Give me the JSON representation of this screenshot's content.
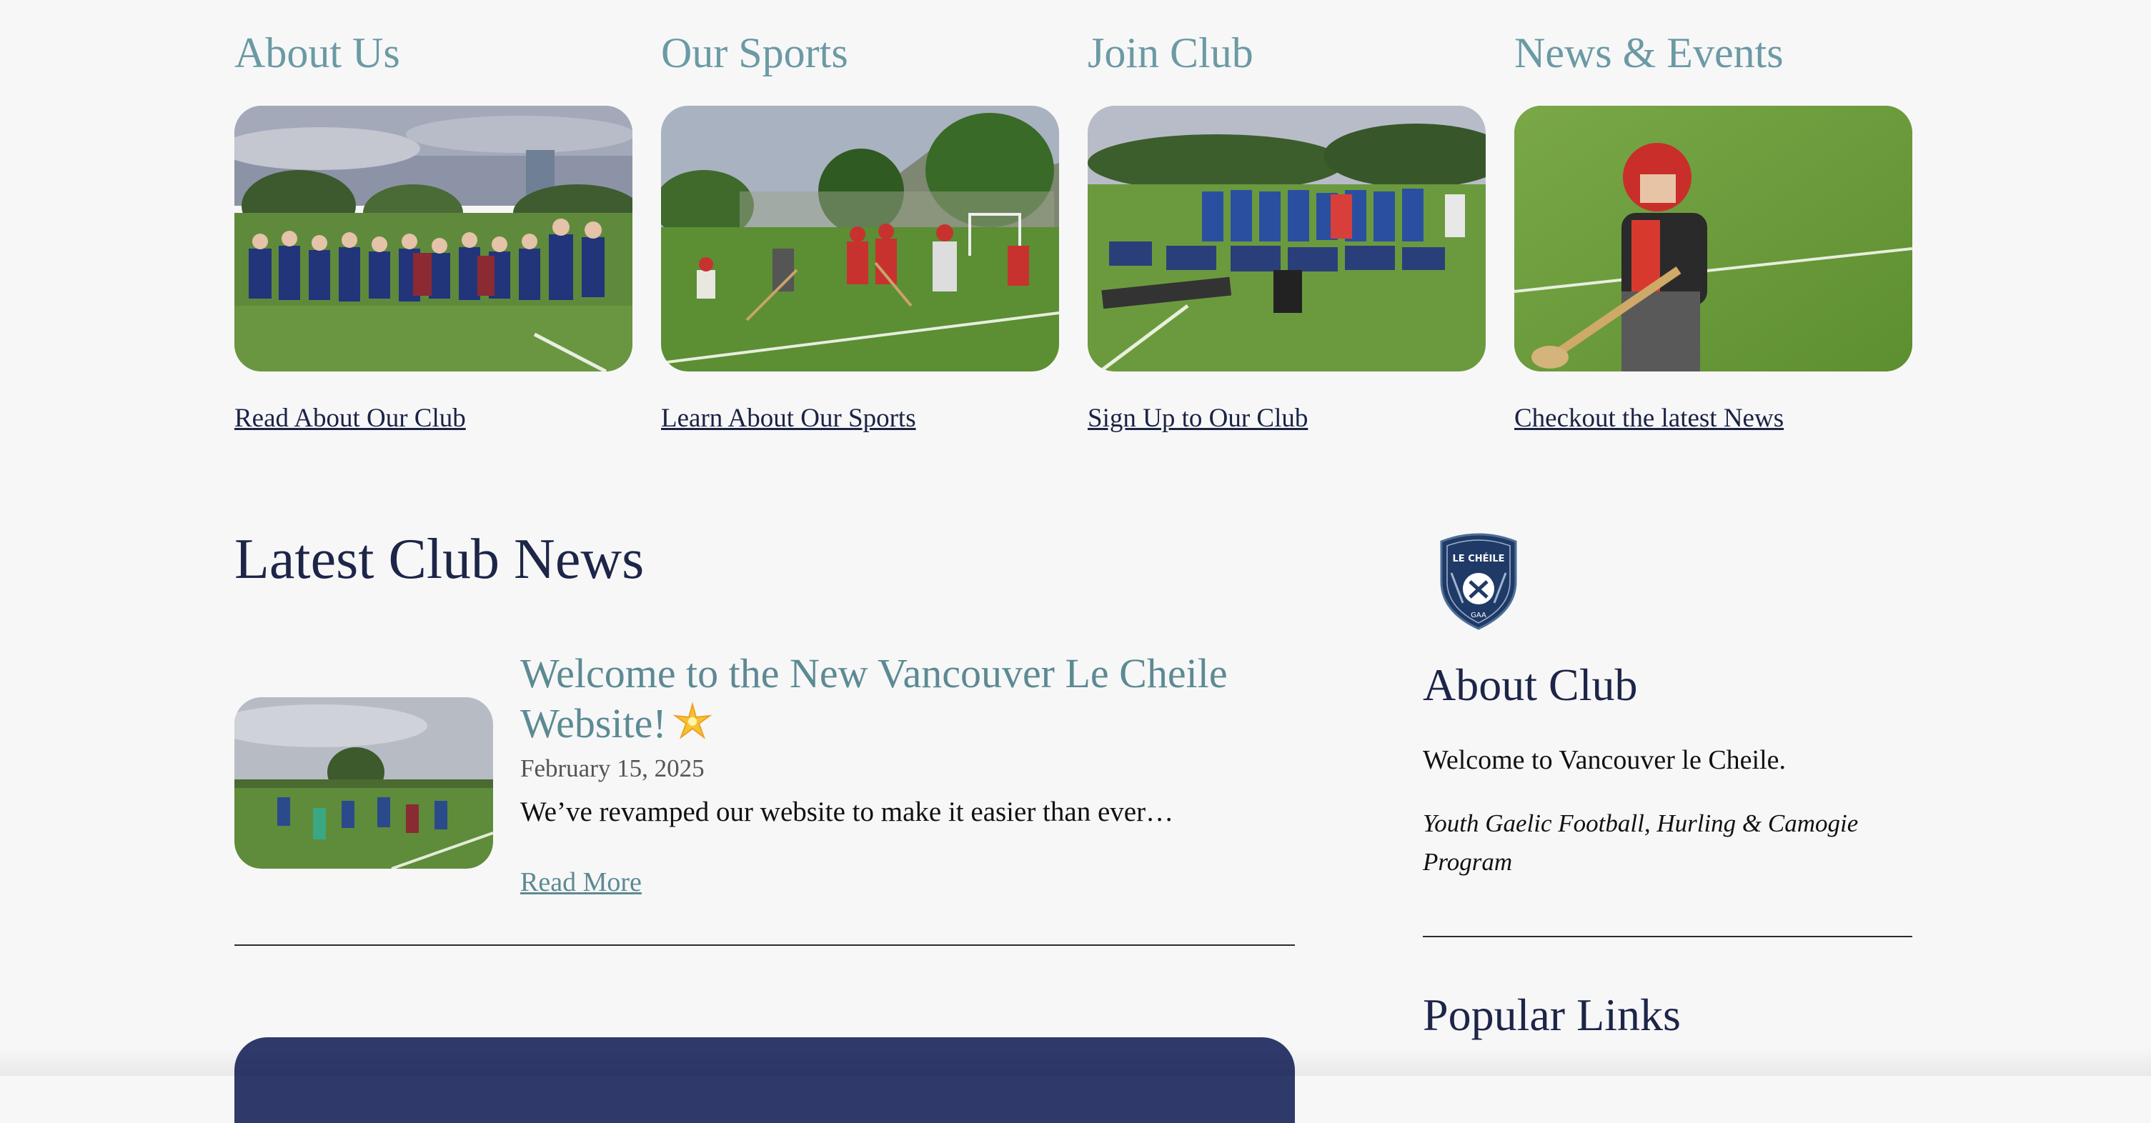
{
  "features": [
    {
      "title": "About Us",
      "link": "Read About Our Club",
      "image": "team-photo-field"
    },
    {
      "title": "Our Sports",
      "link": "Learn About Our Sports",
      "image": "hurling-game-photo"
    },
    {
      "title": "Join Club",
      "link": "Sign Up to Our Club",
      "image": "kids-group-photo"
    },
    {
      "title": "News & Events",
      "link": "Checkout the latest News",
      "image": "hurling-player-photo"
    }
  ],
  "news": {
    "heading": "Latest Club News",
    "article": {
      "title": "Welcome to the New Vancouver Le Cheile Website!",
      "date": "February 15, 2025",
      "excerpt": "We’ve revamped our website to make it easier than ever…",
      "read_more": "Read More",
      "icon": "sparkle-star-emoji"
    }
  },
  "sidebar": {
    "crest_text": "LE CHÉILE",
    "crest_sub": "GAA",
    "about_heading": "About Club",
    "welcome": "Welcome to Vancouver le Cheile.",
    "tagline": "Youth Gaelic Football, Hurling & Camogie Program",
    "links_heading": "Popular Links"
  },
  "colors": {
    "teal_heading": "#6b9aa4",
    "navy": "#1d2548",
    "banner": "#2f3a6b",
    "background": "#f7f7f8"
  }
}
